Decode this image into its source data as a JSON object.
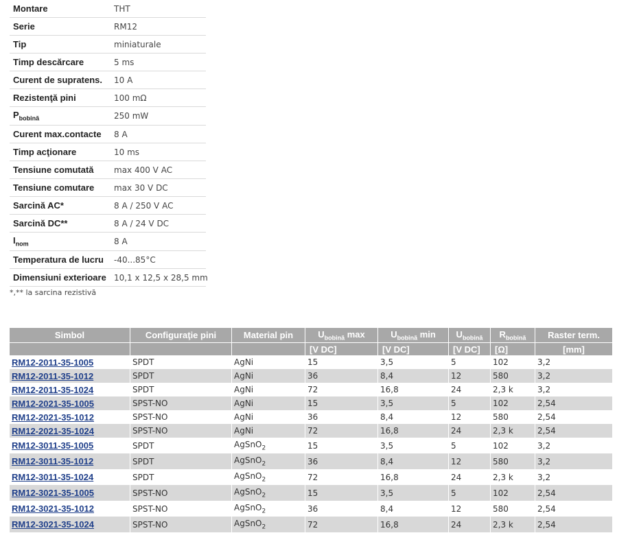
{
  "specs": [
    {
      "label": "Montare",
      "value": "THT"
    },
    {
      "label": "Serie",
      "value": "RM12"
    },
    {
      "label": "Tip",
      "value": "miniaturale"
    },
    {
      "label": "Timp descărcare",
      "value": "5 ms"
    },
    {
      "label": "Curent de supratens.",
      "value": "10 A"
    },
    {
      "label": "Rezistenţă pini",
      "value": "100 mΩ"
    },
    {
      "label": "P",
      "sub": "bobină",
      "value": "250 mW"
    },
    {
      "label": "Curent max.contacte",
      "value": "8 A"
    },
    {
      "label": "Timp acţionare",
      "value": "10 ms"
    },
    {
      "label": "Tensiune comutată",
      "value": "max 400 V AC"
    },
    {
      "label": "Tensiune comutare",
      "value": "max 30 V DC"
    },
    {
      "label": "Sarcină AC*",
      "value": "8 A / 250 V AC"
    },
    {
      "label": "Sarcină DC**",
      "value": "8 A / 24 V DC"
    },
    {
      "label": "I",
      "sub": "nom",
      "value": "8 A"
    },
    {
      "label": "Temperatura de lucru",
      "value": "-40...85°C"
    },
    {
      "label": "Dimensiuni exterioare",
      "value": "10,1 x 12,5 x 28,5 mm"
    }
  ],
  "note": "*,** la sarcina rezistivă",
  "table": {
    "headers": [
      {
        "main": "Simbol"
      },
      {
        "main": "Configuraţie pini"
      },
      {
        "main": "Material pin"
      },
      {
        "main": "U",
        "sub": "bobină",
        "suffix": " max"
      },
      {
        "main": "U",
        "sub": "bobină",
        "suffix": " min"
      },
      {
        "main": "U",
        "sub": "bobină",
        "suffix": ""
      },
      {
        "main": "R",
        "sub": "bobină",
        "suffix": ""
      },
      {
        "main": "Raster term."
      }
    ],
    "units": [
      "",
      "",
      "",
      "[V DC]",
      "[V DC]",
      "[V DC]",
      "[Ω]",
      "[mm]"
    ],
    "rows": [
      {
        "symbol": "RM12-2011-35-1005",
        "config": "SPDT",
        "material": "AgNi",
        "umax": "15",
        "umin": "3,5",
        "u": "5",
        "r": "102",
        "raster": "3,2"
      },
      {
        "symbol": "RM12-2011-35-1012",
        "config": "SPDT",
        "material": "AgNi",
        "umax": "36",
        "umin": "8,4",
        "u": "12",
        "r": "580",
        "raster": "3,2"
      },
      {
        "symbol": "RM12-2011-35-1024",
        "config": "SPDT",
        "material": "AgNi",
        "umax": "72",
        "umin": "16,8",
        "u": "24",
        "r": "2,3 k",
        "raster": "3,2"
      },
      {
        "symbol": "RM12-2021-35-1005",
        "config": "SPST-NO",
        "material": "AgNi",
        "umax": "15",
        "umin": "3,5",
        "u": "5",
        "r": "102",
        "raster": "2,54"
      },
      {
        "symbol": "RM12-2021-35-1012",
        "config": "SPST-NO",
        "material": "AgNi",
        "umax": "36",
        "umin": "8,4",
        "u": "12",
        "r": "580",
        "raster": "2,54"
      },
      {
        "symbol": "RM12-2021-35-1024",
        "config": "SPST-NO",
        "material": "AgNi",
        "umax": "72",
        "umin": "16,8",
        "u": "24",
        "r": "2,3 k",
        "raster": "2,54"
      },
      {
        "symbol": "RM12-3011-35-1005",
        "config": "SPDT",
        "material": "AgSnO",
        "matsub": "2",
        "umax": "15",
        "umin": "3,5",
        "u": "5",
        "r": "102",
        "raster": "3,2"
      },
      {
        "symbol": "RM12-3011-35-1012",
        "config": "SPDT",
        "material": "AgSnO",
        "matsub": "2",
        "umax": "36",
        "umin": "8,4",
        "u": "12",
        "r": "580",
        "raster": "3,2"
      },
      {
        "symbol": "RM12-3011-35-1024",
        "config": "SPDT",
        "material": "AgSnO",
        "matsub": "2",
        "umax": "72",
        "umin": "16,8",
        "u": "24",
        "r": "2,3 k",
        "raster": "3,2"
      },
      {
        "symbol": "RM12-3021-35-1005",
        "config": "SPST-NO",
        "material": "AgSnO",
        "matsub": "2",
        "umax": "15",
        "umin": "3,5",
        "u": "5",
        "r": "102",
        "raster": "2,54"
      },
      {
        "symbol": "RM12-3021-35-1012",
        "config": "SPST-NO",
        "material": "AgSnO",
        "matsub": "2",
        "umax": "36",
        "umin": "8,4",
        "u": "12",
        "r": "580",
        "raster": "2,54"
      },
      {
        "symbol": "RM12-3021-35-1024",
        "config": "SPST-NO",
        "material": "AgSnO",
        "matsub": "2",
        "umax": "72",
        "umin": "16,8",
        "u": "24",
        "r": "2,3 k",
        "raster": "2,54"
      }
    ]
  },
  "colors": {
    "header_bg": "#a8a8a8",
    "row_shade": "#d8d8d8",
    "link": "#1f3f8a"
  }
}
